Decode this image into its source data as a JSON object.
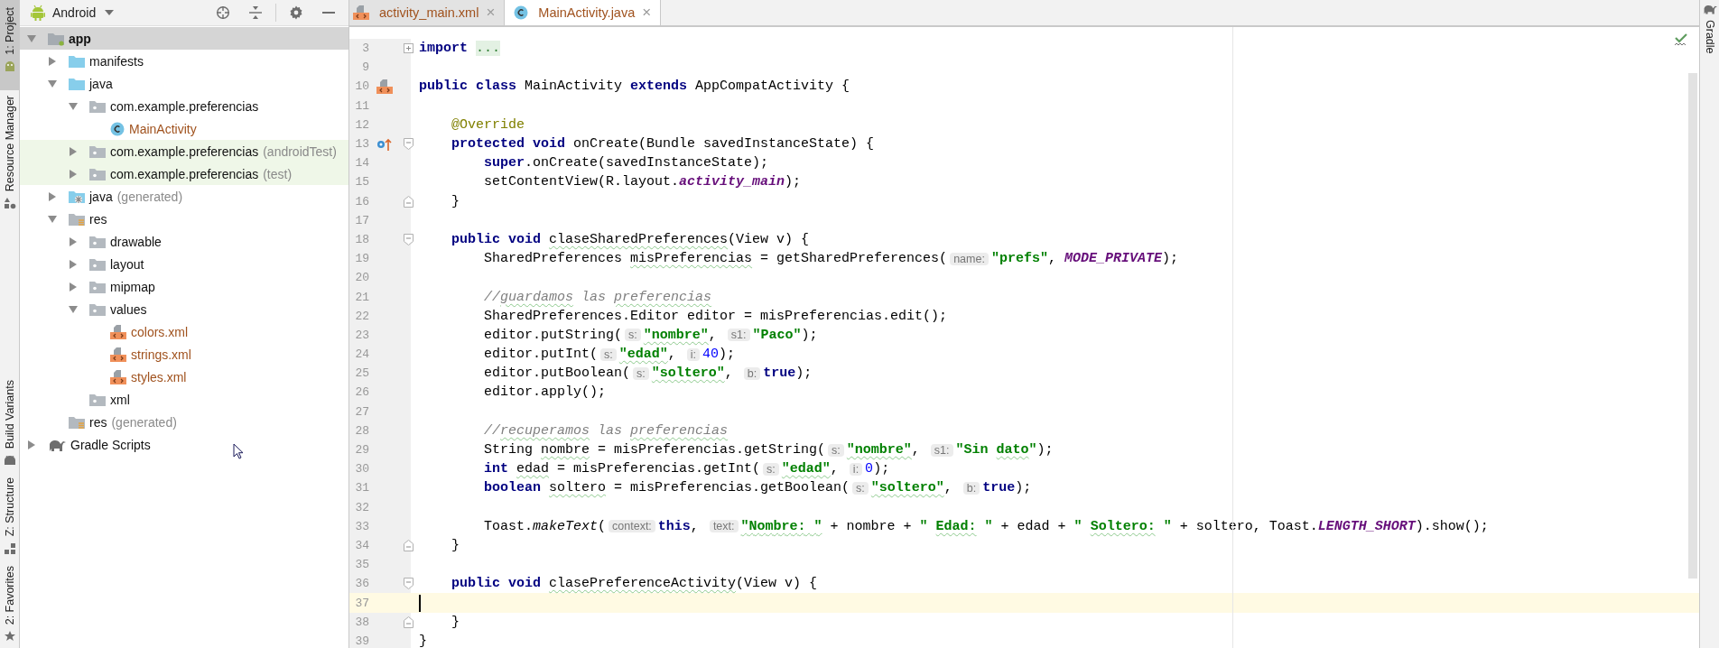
{
  "tool_stripe_left": [
    {
      "label": "1: Project",
      "kind": "android",
      "selected": true
    },
    {
      "label": "Resource Manager",
      "kind": "shapes",
      "selected": false
    },
    {
      "label": "Build Variants",
      "kind": "robot",
      "selected": false
    },
    {
      "label": "Z: Structure",
      "kind": "blocks",
      "selected": false
    },
    {
      "label": "2: Favorites",
      "kind": "star",
      "selected": false
    }
  ],
  "project_panel": {
    "view": "Android",
    "tree": [
      {
        "label": "app",
        "kind": "module",
        "bold": true,
        "selected": true,
        "expanded": true,
        "children": [
          {
            "label": "manifests",
            "kind": "blue-folder",
            "selected": false,
            "expanded": false
          },
          {
            "label": "java",
            "kind": "blue-folder",
            "selected": false,
            "expanded": true,
            "children": [
              {
                "label": "com.example.preferencias",
                "kind": "package",
                "selected": false,
                "expanded": true,
                "children": [
                  {
                    "label": "MainActivity",
                    "kind": "class",
                    "selected": false,
                    "color": "#a0521e"
                  }
                ]
              },
              {
                "label": "com.example.preferencias",
                "suffix": "(androidTest)",
                "kind": "package",
                "selected": false,
                "tinted": true,
                "expanded": false
              },
              {
                "label": "com.example.preferencias",
                "suffix": "(test)",
                "kind": "package",
                "selected": false,
                "tinted": true,
                "expanded": false
              }
            ]
          },
          {
            "label": "java",
            "suffix": "(generated)",
            "kind": "generated-folder",
            "selected": false,
            "expanded": false
          },
          {
            "label": "res",
            "kind": "res-folder",
            "selected": false,
            "expanded": true,
            "children": [
              {
                "label": "drawable",
                "kind": "package",
                "selected": false,
                "expanded": false
              },
              {
                "label": "layout",
                "kind": "package",
                "selected": false,
                "expanded": false
              },
              {
                "label": "mipmap",
                "kind": "package",
                "selected": false,
                "expanded": false
              },
              {
                "label": "values",
                "kind": "package",
                "selected": false,
                "expanded": true,
                "children": [
                  {
                    "label": "colors.xml",
                    "kind": "xml-file",
                    "selected": false,
                    "color": "#a0521e"
                  },
                  {
                    "label": "strings.xml",
                    "kind": "xml-file",
                    "selected": false,
                    "color": "#a0521e"
                  },
                  {
                    "label": "styles.xml",
                    "kind": "xml-file",
                    "selected": false,
                    "color": "#a0521e"
                  }
                ]
              },
              {
                "label": "xml",
                "kind": "package",
                "selected": false
              }
            ]
          },
          {
            "label": "res",
            "suffix": "(generated)",
            "kind": "res-folder",
            "selected": false
          }
        ]
      },
      {
        "label": "Gradle Scripts",
        "kind": "elephant",
        "selected": false,
        "expanded": false
      }
    ]
  },
  "editor_tabs": [
    {
      "label": "activity_main.xml",
      "kind": "xml-file",
      "selected": false,
      "close": "×"
    },
    {
      "label": "MainActivity.java",
      "kind": "class",
      "selected": true,
      "close": "×"
    }
  ],
  "code_lines": [
    {
      "number": "3",
      "current": false,
      "gutter": [
        {
          "kind": "fold-collapsed"
        }
      ],
      "tokens": [
        {
          "kind": "kw",
          "text": "import "
        },
        {
          "kind": "folded",
          "text": "..."
        }
      ]
    },
    {
      "number": "9",
      "current": false
    },
    {
      "number": "10",
      "current": false,
      "gutter": [
        {
          "kind": "xml-marker"
        }
      ],
      "tokens": [
        {
          "kind": "kw",
          "text": "public class "
        },
        {
          "kind": "plain",
          "text": "MainActivity "
        },
        {
          "kind": "kw",
          "text": "extends "
        },
        {
          "kind": "plain",
          "text": "AppCompatActivity {"
        }
      ]
    },
    {
      "number": "11",
      "current": false
    },
    {
      "number": "12",
      "current": false,
      "tokens": [
        {
          "kind": "annot",
          "text": "    @Override"
        }
      ]
    },
    {
      "number": "13",
      "current": false,
      "gutter": [
        {
          "kind": "override-marker"
        },
        {
          "kind": "fold-start"
        }
      ],
      "tokens": [
        {
          "kind": "kw",
          "text": "    protected void "
        },
        {
          "kind": "plain",
          "text": "onCreate(Bundle savedInstanceState) {"
        }
      ]
    },
    {
      "number": "14",
      "current": false,
      "tokens": [
        {
          "kind": "kw",
          "text": "        super"
        },
        {
          "kind": "plain",
          "text": ".onCreate(savedInstanceState);"
        }
      ]
    },
    {
      "number": "15",
      "current": false,
      "tokens": [
        {
          "kind": "plain",
          "text": "        setContentView(R.layout."
        },
        {
          "kind": "field",
          "text": "activity_main"
        },
        {
          "kind": "plain",
          "text": ");"
        }
      ]
    },
    {
      "number": "16",
      "current": false,
      "gutter": [
        {
          "kind": "fold-end"
        }
      ],
      "tokens": [
        {
          "kind": "plain",
          "text": "    }"
        }
      ]
    },
    {
      "number": "17",
      "current": false
    },
    {
      "number": "18",
      "current": false,
      "gutter": [
        {
          "kind": "fold-start"
        }
      ],
      "tokens": [
        {
          "kind": "kw",
          "text": "    public void "
        },
        {
          "kind": "plain",
          "text": "claseSharedPreferences",
          "typo": true
        },
        {
          "kind": "plain",
          "text": "(View v) {"
        }
      ]
    },
    {
      "number": "19",
      "current": false,
      "tokens": [
        {
          "kind": "plain",
          "text": "        SharedPreferences "
        },
        {
          "kind": "plain",
          "text": "misPreferencias",
          "typo": true
        },
        {
          "kind": "plain",
          "text": " = getSharedPreferences("
        },
        {
          "kind": "hint",
          "text": "name:"
        },
        {
          "kind": "str",
          "text": "\"prefs\""
        },
        {
          "kind": "plain",
          "text": ", "
        },
        {
          "kind": "field",
          "text": "MODE_PRIVATE"
        },
        {
          "kind": "plain",
          "text": ");"
        }
      ]
    },
    {
      "number": "20",
      "current": false
    },
    {
      "number": "21",
      "current": false,
      "tokens": [
        {
          "kind": "comment",
          "text": "        //"
        },
        {
          "kind": "comment",
          "text": "guardamos",
          "typo": true
        },
        {
          "kind": "comment",
          "text": " las "
        },
        {
          "kind": "comment",
          "text": "preferencias",
          "typo": true
        }
      ]
    },
    {
      "number": "22",
      "current": false,
      "tokens": [
        {
          "kind": "plain",
          "text": "        SharedPreferences.Editor editor = misPreferencias.edit();"
        }
      ]
    },
    {
      "number": "23",
      "current": false,
      "tokens": [
        {
          "kind": "plain",
          "text": "        editor.putString("
        },
        {
          "kind": "hint",
          "text": "s:"
        },
        {
          "kind": "str",
          "text": "\"nombre\"",
          "typo": true
        },
        {
          "kind": "plain",
          "text": ", "
        },
        {
          "kind": "hint",
          "text": "s1:"
        },
        {
          "kind": "str",
          "text": "\"Paco\""
        },
        {
          "kind": "plain",
          "text": ");"
        }
      ]
    },
    {
      "number": "24",
      "current": false,
      "tokens": [
        {
          "kind": "plain",
          "text": "        editor.putInt("
        },
        {
          "kind": "hint",
          "text": "s:"
        },
        {
          "kind": "str",
          "text": "\"edad\"",
          "typo": true
        },
        {
          "kind": "plain",
          "text": ", "
        },
        {
          "kind": "hint",
          "text": "i:"
        },
        {
          "kind": "num",
          "text": "40"
        },
        {
          "kind": "plain",
          "text": ");"
        }
      ]
    },
    {
      "number": "25",
      "current": false,
      "tokens": [
        {
          "kind": "plain",
          "text": "        editor.putBoolean("
        },
        {
          "kind": "hint",
          "text": "s:"
        },
        {
          "kind": "str",
          "text": "\"soltero\"",
          "typo": true
        },
        {
          "kind": "plain",
          "text": ", "
        },
        {
          "kind": "hint",
          "text": "b:"
        },
        {
          "kind": "kw",
          "text": "true"
        },
        {
          "kind": "plain",
          "text": ");"
        }
      ]
    },
    {
      "number": "26",
      "current": false,
      "tokens": [
        {
          "kind": "plain",
          "text": "        editor.apply();"
        }
      ]
    },
    {
      "number": "27",
      "current": false
    },
    {
      "number": "28",
      "current": false,
      "tokens": [
        {
          "kind": "comment",
          "text": "        //"
        },
        {
          "kind": "comment",
          "text": "recuperamos",
          "typo": true
        },
        {
          "kind": "comment",
          "text": " las "
        },
        {
          "kind": "comment",
          "text": "preferencias",
          "typo": true
        }
      ]
    },
    {
      "number": "29",
      "current": false,
      "tokens": [
        {
          "kind": "plain",
          "text": "        String "
        },
        {
          "kind": "plain",
          "text": "nombre",
          "typo": true
        },
        {
          "kind": "plain",
          "text": " = misPreferencias.getString("
        },
        {
          "kind": "hint",
          "text": "s:"
        },
        {
          "kind": "str",
          "text": "\"nombre\"",
          "typo": true
        },
        {
          "kind": "plain",
          "text": ", "
        },
        {
          "kind": "hint",
          "text": "s1:"
        },
        {
          "kind": "str",
          "text": "\"Sin "
        },
        {
          "kind": "str",
          "text": "dato",
          "typo": true
        },
        {
          "kind": "str",
          "text": "\""
        },
        {
          "kind": "plain",
          "text": ");"
        }
      ]
    },
    {
      "number": "30",
      "current": false,
      "tokens": [
        {
          "kind": "kw",
          "text": "        int "
        },
        {
          "kind": "plain",
          "text": "edad",
          "typo": true
        },
        {
          "kind": "plain",
          "text": " = misPreferencias.getInt("
        },
        {
          "kind": "hint",
          "text": "s:"
        },
        {
          "kind": "str",
          "text": "\"edad\"",
          "typo": true
        },
        {
          "kind": "plain",
          "text": ", "
        },
        {
          "kind": "hint",
          "text": "i:"
        },
        {
          "kind": "num",
          "text": "0"
        },
        {
          "kind": "plain",
          "text": ");"
        }
      ]
    },
    {
      "number": "31",
      "current": false,
      "tokens": [
        {
          "kind": "kw",
          "text": "        boolean "
        },
        {
          "kind": "plain",
          "text": "soltero",
          "typo": true
        },
        {
          "kind": "plain",
          "text": " = misPreferencias.getBoolean("
        },
        {
          "kind": "hint",
          "text": "s:"
        },
        {
          "kind": "str",
          "text": "\"soltero\"",
          "typo": true
        },
        {
          "kind": "plain",
          "text": ", "
        },
        {
          "kind": "hint",
          "text": "b:"
        },
        {
          "kind": "kw",
          "text": "true"
        },
        {
          "kind": "plain",
          "text": ");"
        }
      ]
    },
    {
      "number": "32",
      "current": false
    },
    {
      "number": "33",
      "current": false,
      "tokens": [
        {
          "kind": "plain",
          "text": "        Toast."
        },
        {
          "kind": "italic",
          "text": "makeText"
        },
        {
          "kind": "plain",
          "text": "("
        },
        {
          "kind": "hint",
          "text": "context:"
        },
        {
          "kind": "kw",
          "text": "this"
        },
        {
          "kind": "plain",
          "text": ", "
        },
        {
          "kind": "hint",
          "text": "text:"
        },
        {
          "kind": "str",
          "text": "\"Nombre: \"",
          "typo": true
        },
        {
          "kind": "plain",
          "text": " + nombre + "
        },
        {
          "kind": "str",
          "text": "\" "
        },
        {
          "kind": "str",
          "text": "Edad:",
          "typo": true
        },
        {
          "kind": "str",
          "text": " \""
        },
        {
          "kind": "plain",
          "text": " + edad + "
        },
        {
          "kind": "str",
          "text": "\" "
        },
        {
          "kind": "str",
          "text": "Soltero:",
          "typo": true
        },
        {
          "kind": "str",
          "text": " \""
        },
        {
          "kind": "plain",
          "text": " + soltero, Toast."
        },
        {
          "kind": "field",
          "text": "LENGTH_SHORT"
        },
        {
          "kind": "plain",
          "text": ").show();"
        }
      ]
    },
    {
      "number": "34",
      "current": false,
      "gutter": [
        {
          "kind": "fold-end"
        }
      ],
      "tokens": [
        {
          "kind": "plain",
          "text": "    }"
        }
      ]
    },
    {
      "number": "35",
      "current": false
    },
    {
      "number": "36",
      "current": false,
      "gutter": [
        {
          "kind": "fold-start"
        }
      ],
      "tokens": [
        {
          "kind": "kw",
          "text": "    public void "
        },
        {
          "kind": "plain",
          "text": "clasePreferenceActivity",
          "typo": true
        },
        {
          "kind": "plain",
          "text": "(View v) {"
        }
      ]
    },
    {
      "number": "37",
      "current": true
    },
    {
      "number": "38",
      "current": false,
      "gutter": [
        {
          "kind": "fold-end"
        }
      ],
      "tokens": [
        {
          "kind": "plain",
          "text": "    }"
        }
      ]
    },
    {
      "number": "39",
      "current": false,
      "tokens": [
        {
          "kind": "plain",
          "text": "}"
        }
      ]
    }
  ],
  "tool_stripe_right": [
    {
      "label": "Gradle",
      "kind": "elephant",
      "selected": false
    }
  ]
}
